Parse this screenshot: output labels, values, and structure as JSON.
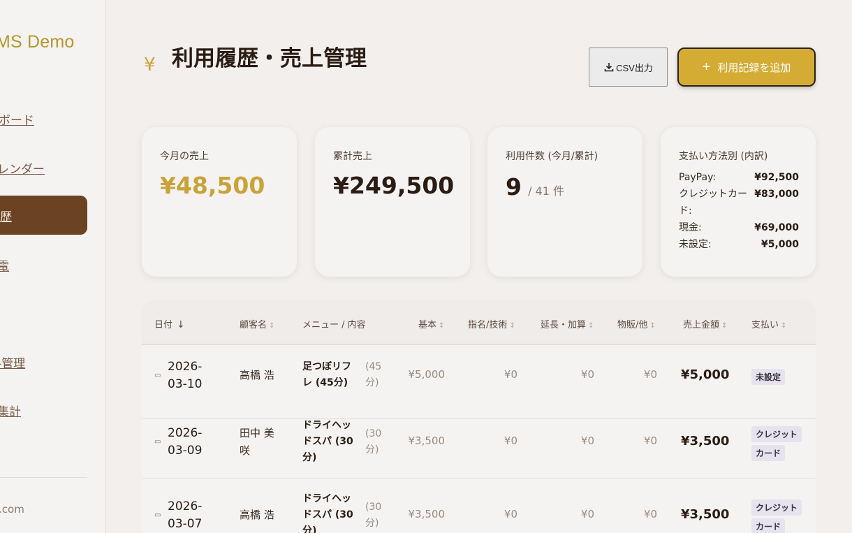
{
  "sidebar": {
    "brand": "MS Demo",
    "items": [
      {
        "label": "ボード"
      },
      {
        "label": "レンダー"
      },
      {
        "label": "歴"
      },
      {
        "label": "電"
      },
      {
        "label": "-管理"
      },
      {
        "label": "集計"
      }
    ],
    "email": ".com"
  },
  "header": {
    "icon": "¥",
    "title": "利用履歴・売上管理",
    "csv_label": "CSV出力",
    "add_label": "利用記録を追加"
  },
  "cards": {
    "monthly": {
      "label": "今月の売上",
      "value": "¥48,500"
    },
    "total": {
      "label": "累計売上",
      "value": "¥249,500"
    },
    "count": {
      "label": "利用件数 (今月/累計)",
      "month": "9",
      "total": "/ 41 件"
    },
    "payment": {
      "label": "支払い方法別 (内訳)",
      "rows": [
        {
          "name": "PayPay:",
          "value": "¥92,500"
        },
        {
          "name": "クレジットカード:",
          "value": "¥83,000"
        },
        {
          "name": "現金:",
          "value": "¥69,000"
        },
        {
          "name": "未設定:",
          "value": "¥5,000"
        }
      ]
    }
  },
  "table": {
    "headers": {
      "date": "日付",
      "customer": "顧客名",
      "menu": "メニュー / 内容",
      "base": "基本",
      "nomination": "指名/技術",
      "extension": "延長・加算",
      "goods": "物販/他",
      "amount": "売上金額",
      "payment": "支払い"
    },
    "sort_icon": "↓",
    "rows": [
      {
        "date1": "2026-",
        "date2": "03-10",
        "customer1": "高橋 浩",
        "customer2": "",
        "menu1": "足つぼリフ",
        "menu2": "レ (45分)",
        "menu3": "",
        "dur1": "(45",
        "dur2": "分)",
        "base": "¥5,000",
        "nomination": "¥0",
        "extension": "¥0",
        "goods": "¥0",
        "amount": "¥5,000",
        "pay1": "未設定",
        "pay2": ""
      },
      {
        "date1": "2026-",
        "date2": "03-09",
        "customer1": "田中 美",
        "customer2": "咲",
        "menu1": "ドライヘッ",
        "menu2": "ドスパ (30",
        "menu3": "分)",
        "dur1": "(30",
        "dur2": "分)",
        "base": "¥3,500",
        "nomination": "¥0",
        "extension": "¥0",
        "goods": "¥0",
        "amount": "¥3,500",
        "pay1": "クレジット",
        "pay2": "カード"
      },
      {
        "date1": "2026-",
        "date2": "03-07",
        "customer1": "高橋 浩",
        "customer2": "",
        "menu1": "ドライヘッ",
        "menu2": "ドスパ (30",
        "menu3": "分)",
        "dur1": "(30",
        "dur2": "分)",
        "base": "¥3,500",
        "nomination": "¥0",
        "extension": "¥0",
        "goods": "¥0",
        "amount": "¥3,500",
        "pay1": "クレジット",
        "pay2": "カード"
      }
    ]
  }
}
